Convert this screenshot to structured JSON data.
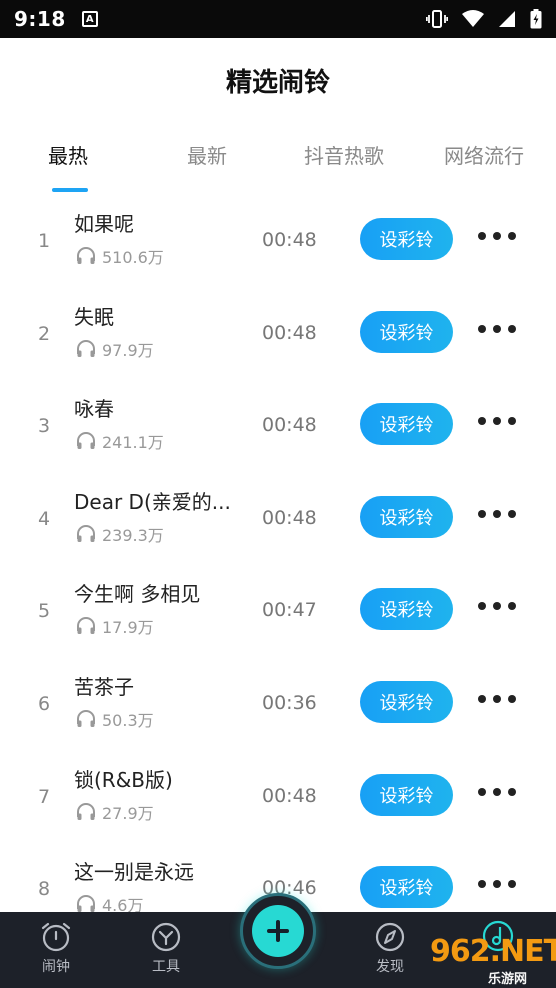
{
  "status_bar": {
    "time": "9:18",
    "notification_badge": "A"
  },
  "header": {
    "title": "精选闹铃"
  },
  "tabs": [
    {
      "label": "最热",
      "active": true
    },
    {
      "label": "最新",
      "active": false
    },
    {
      "label": "抖音热歌",
      "active": false
    },
    {
      "label": "网络流行",
      "active": false
    }
  ],
  "songs": [
    {
      "rank": "1",
      "title": "如果呢",
      "plays": "510.6万",
      "duration": "00:48",
      "button": "设彩铃"
    },
    {
      "rank": "2",
      "title": "失眠",
      "plays": "97.9万",
      "duration": "00:48",
      "button": "设彩铃"
    },
    {
      "rank": "3",
      "title": "咏春",
      "plays": "241.1万",
      "duration": "00:48",
      "button": "设彩铃"
    },
    {
      "rank": "4",
      "title": "Dear D(亲爱的...",
      "plays": "239.3万",
      "duration": "00:48",
      "button": "设彩铃"
    },
    {
      "rank": "5",
      "title": "今生啊 多相见",
      "plays": "17.9万",
      "duration": "00:47",
      "button": "设彩铃"
    },
    {
      "rank": "6",
      "title": "苦茶子",
      "plays": "50.3万",
      "duration": "00:36",
      "button": "设彩铃"
    },
    {
      "rank": "7",
      "title": "锁(R&B版)",
      "plays": "27.9万",
      "duration": "00:48",
      "button": "设彩铃"
    },
    {
      "rank": "8",
      "title": "这一别是永远",
      "plays": "4.6万",
      "duration": "00:46",
      "button": "设彩铃"
    }
  ],
  "bottom_nav": {
    "items": [
      {
        "label": "闹钟",
        "icon": "alarm-clock-icon"
      },
      {
        "label": "工具",
        "icon": "tools-icon"
      },
      {
        "label": "发现",
        "icon": "compass-icon"
      }
    ],
    "fab_icon": "plus-icon"
  },
  "watermark": {
    "main": "962.NET",
    "sub": "乐游网"
  },
  "colors": {
    "accent": "#1ea4f4",
    "fab": "#27d9d3",
    "nav_bg": "#1d2129"
  }
}
